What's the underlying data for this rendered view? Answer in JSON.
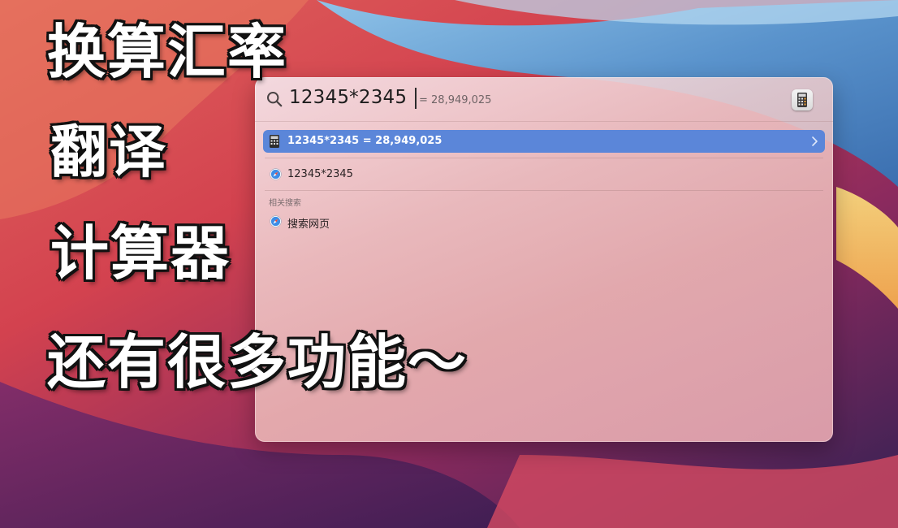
{
  "captions": {
    "line1": "换算汇率",
    "line2": "翻译",
    "line3": "计算器",
    "line4": "还有很多功能～"
  },
  "spotlight": {
    "query": "12345*2345",
    "inline_result": "= 28,949,025",
    "app_icon": "calculator-icon",
    "top_hit": {
      "label": "12345*2345 = 28,949,025",
      "icon": "calculator-icon",
      "selected": true
    },
    "results": [
      {
        "label": "12345*2345",
        "icon": "safari-icon"
      }
    ],
    "section_header": "相关搜索",
    "related": [
      {
        "label": "搜索网页",
        "icon": "safari-icon"
      }
    ]
  },
  "colors": {
    "selection": "#5b86d9",
    "caption_fill": "#ffffff",
    "caption_outline": "#111111"
  }
}
